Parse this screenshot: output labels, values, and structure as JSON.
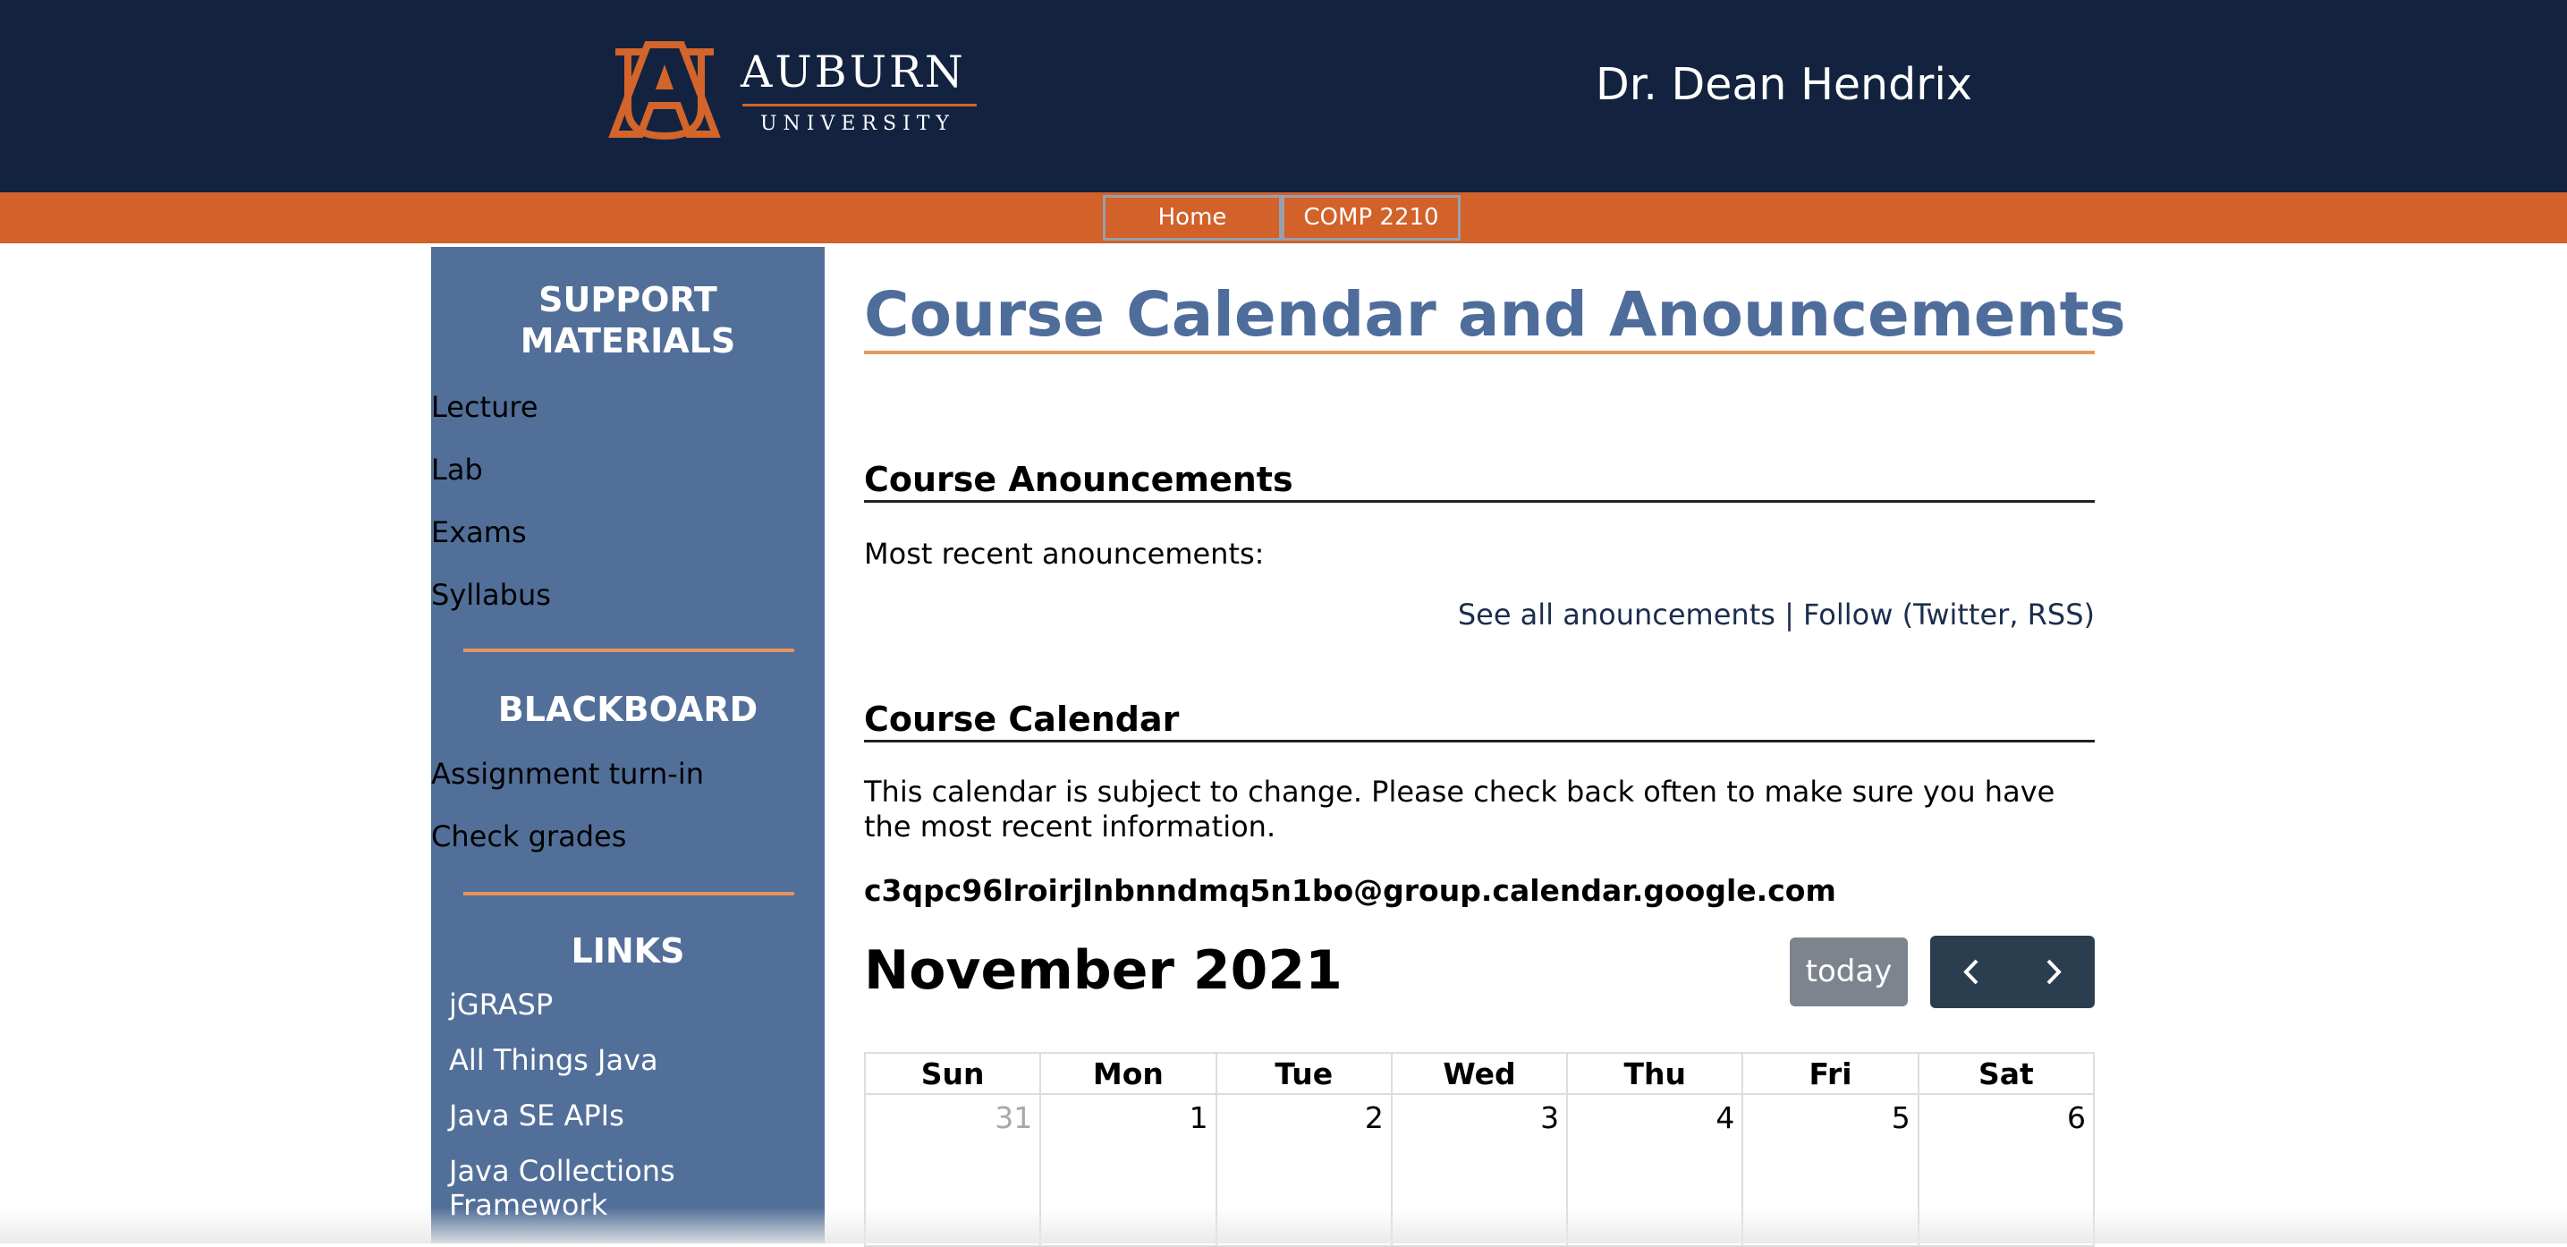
{
  "header": {
    "logo_word": "AUBURN",
    "logo_sub": "UNIVERSITY",
    "professor": "Dr. Dean Hendrix"
  },
  "nav": {
    "items": [
      {
        "label": "Home"
      },
      {
        "label": "COMP 2210"
      }
    ]
  },
  "sidebar": {
    "support_heading_line1": "SUPPORT",
    "support_heading_line2": "MATERIALS",
    "support_links": [
      {
        "label": "Lecture"
      },
      {
        "label": "Lab"
      },
      {
        "label": "Exams"
      },
      {
        "label": "Syllabus"
      }
    ],
    "blackboard_heading": "BLACKBOARD",
    "blackboard_links": [
      {
        "label": "Assignment turn-in"
      },
      {
        "label": "Check grades"
      }
    ],
    "links_heading": "LINKS",
    "links": [
      {
        "label": "jGRASP"
      },
      {
        "label": "All Things Java"
      },
      {
        "label": "Java SE APIs"
      },
      {
        "label": "Java Collections Framework"
      }
    ]
  },
  "main": {
    "title": "Course Calendar and Anouncements",
    "announcements_heading": "Course Anouncements",
    "recent_text": "Most recent anouncements:",
    "see_all": "See all anouncements",
    "separator": " | ",
    "follow_prefix": "Follow (",
    "twitter": "Twitter",
    "comma": ", ",
    "rss": "RSS",
    "close_paren": ")",
    "calendar_heading": "Course Calendar",
    "calendar_note": "This calendar is subject to change. Please check back often to make sure you have the most recent information.",
    "calendar_id": "c3qpc96lroirjlnbnndmq5n1bo@group.calendar.google.com"
  },
  "calendar": {
    "month": "November 2021",
    "today_label": "today",
    "prev_icon": "chevron-left-icon",
    "next_icon": "chevron-right-icon",
    "days": [
      "Sun",
      "Mon",
      "Tue",
      "Wed",
      "Thu",
      "Fri",
      "Sat"
    ],
    "first_week": [
      "31",
      "1",
      "2",
      "3",
      "4",
      "5",
      "6"
    ]
  },
  "colors": {
    "header_bg": "#13233f",
    "nav_bg": "#d2612a",
    "sidebar_bg": "#526f99",
    "title_color": "#4f6d9b",
    "accent": "#e39a5e"
  }
}
